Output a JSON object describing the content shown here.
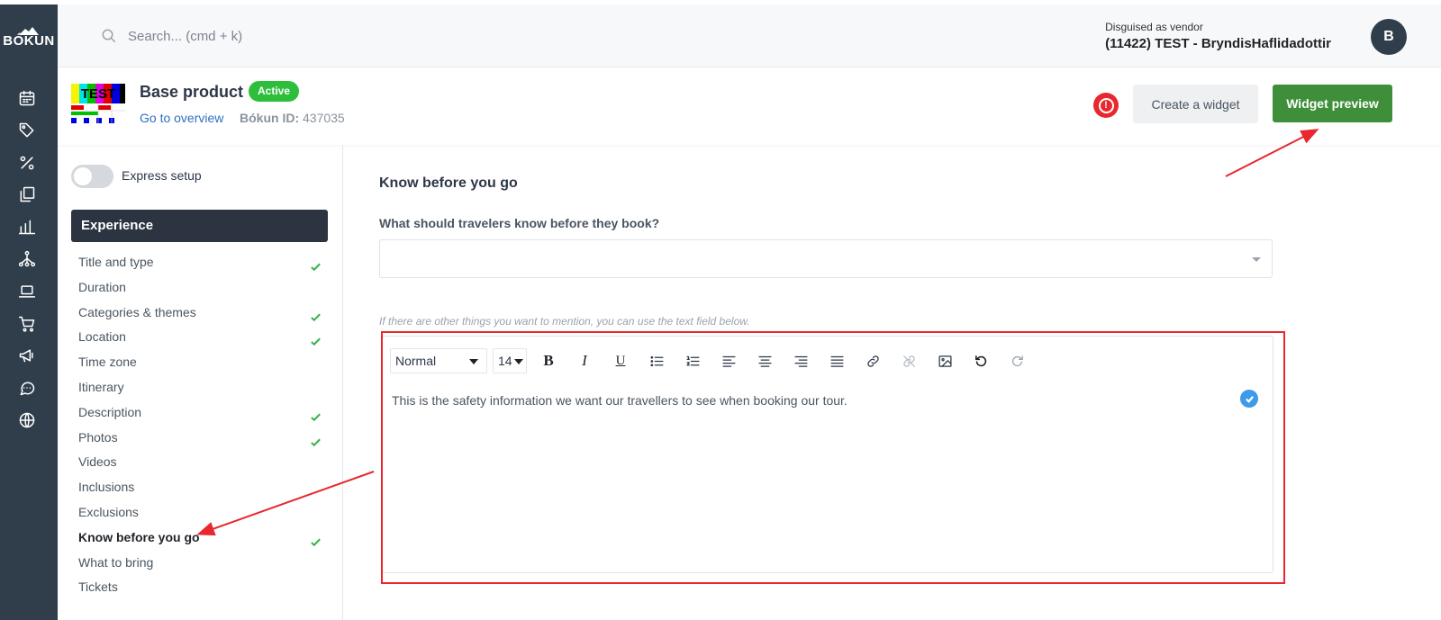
{
  "brand": {
    "name": "BÓKUN"
  },
  "rail": {
    "items": [
      {
        "icon": "calendar-icon"
      },
      {
        "icon": "tag-icon"
      },
      {
        "icon": "percent-icon"
      },
      {
        "icon": "copy-icon"
      },
      {
        "icon": "bar-chart-icon"
      },
      {
        "icon": "network-icon"
      },
      {
        "icon": "laptop-icon"
      },
      {
        "icon": "cart-icon"
      },
      {
        "icon": "megaphone-icon"
      },
      {
        "icon": "chat-icon"
      },
      {
        "icon": "globe-icon"
      }
    ]
  },
  "topbar": {
    "search_placeholder": "Search... (cmd + k)",
    "vendor_caption": "Disguised as vendor",
    "vendor_name": "(11422) TEST - BryndisHaflidadottir",
    "avatar_initial": "B"
  },
  "product": {
    "title": "Base product",
    "status": "Active",
    "overview_link": "Go to overview",
    "id_label": "Bókun ID:",
    "id_value": "437035",
    "create_widget_label": "Create a widget",
    "widget_preview_label": "Widget preview",
    "thumb_text": "TEST"
  },
  "sidebar": {
    "express_label": "Express setup",
    "section_title": "Experience",
    "items": [
      {
        "label": "Title and type",
        "done": true
      },
      {
        "label": "Duration",
        "done": false
      },
      {
        "label": "Categories & themes",
        "done": true
      },
      {
        "label": "Location",
        "done": true
      },
      {
        "label": "Time zone",
        "done": false
      },
      {
        "label": "Itinerary",
        "done": false
      },
      {
        "label": "Description",
        "done": true
      },
      {
        "label": "Photos",
        "done": true
      },
      {
        "label": "Videos",
        "done": false
      },
      {
        "label": "Inclusions",
        "done": false
      },
      {
        "label": "Exclusions",
        "done": false
      },
      {
        "label": "Know before you go",
        "done": true,
        "active": true
      },
      {
        "label": "What to bring",
        "done": false
      },
      {
        "label": "Tickets",
        "done": false
      }
    ]
  },
  "main": {
    "section_title": "Know before you go",
    "question": "What should travelers know before they book?",
    "select_value": "",
    "hint": "If there are other things you want to mention, you can use the text field below.",
    "editor": {
      "style_value": "Normal",
      "size_value": "14",
      "text": "This is the safety information we want our travellers to see when booking our tour."
    }
  },
  "colors": {
    "rail_bg": "#303e4b",
    "active_badge": "#2dbf3c",
    "primary_green": "#3f8f3a",
    "link_blue": "#2f6fbf",
    "check_green": "#38b24a",
    "annotation_red": "#e8282e"
  }
}
